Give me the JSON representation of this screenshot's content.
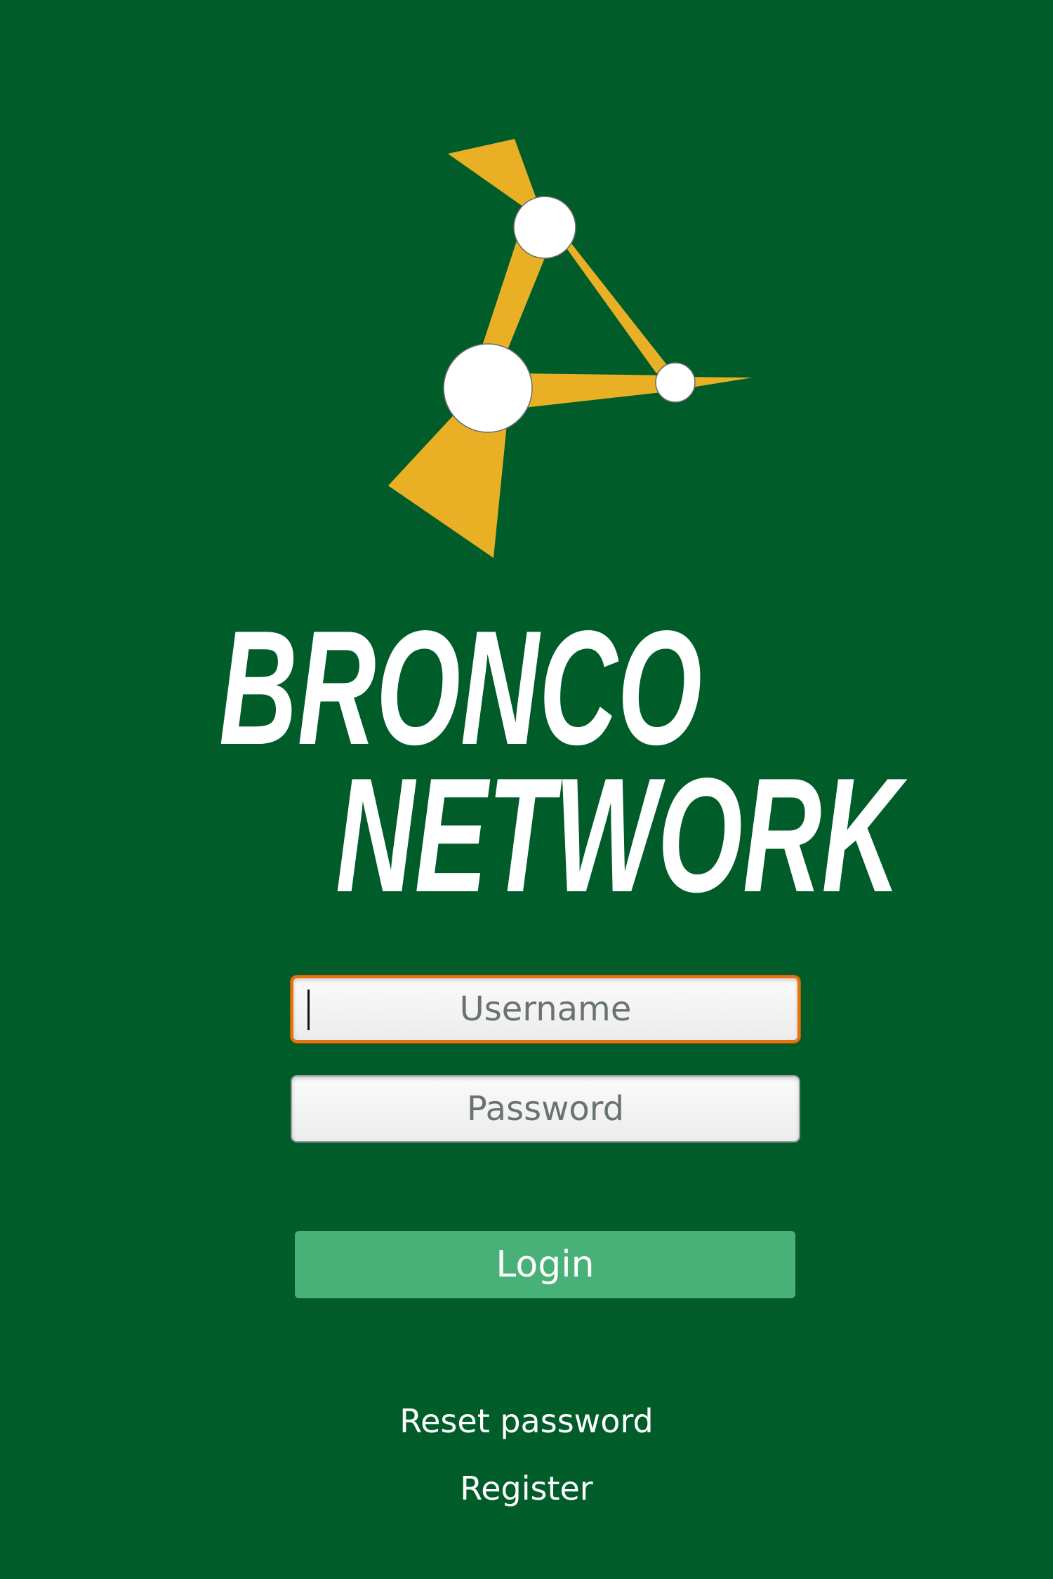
{
  "app": {
    "brand_line1": "Bronco",
    "brand_line2": "Network",
    "logo_icon": "network-nodes-logo-icon"
  },
  "form": {
    "username_placeholder": "Username",
    "username_value": "",
    "password_placeholder": "Password",
    "password_value": "",
    "login_label": "Login"
  },
  "links": {
    "reset_password": "Reset password",
    "register": "Register"
  },
  "colors": {
    "background": "#005d2a",
    "logo_accent": "#e9b025",
    "focus_ring": "#e8730e",
    "login_button": "#48b178",
    "text": "#ffffff"
  }
}
